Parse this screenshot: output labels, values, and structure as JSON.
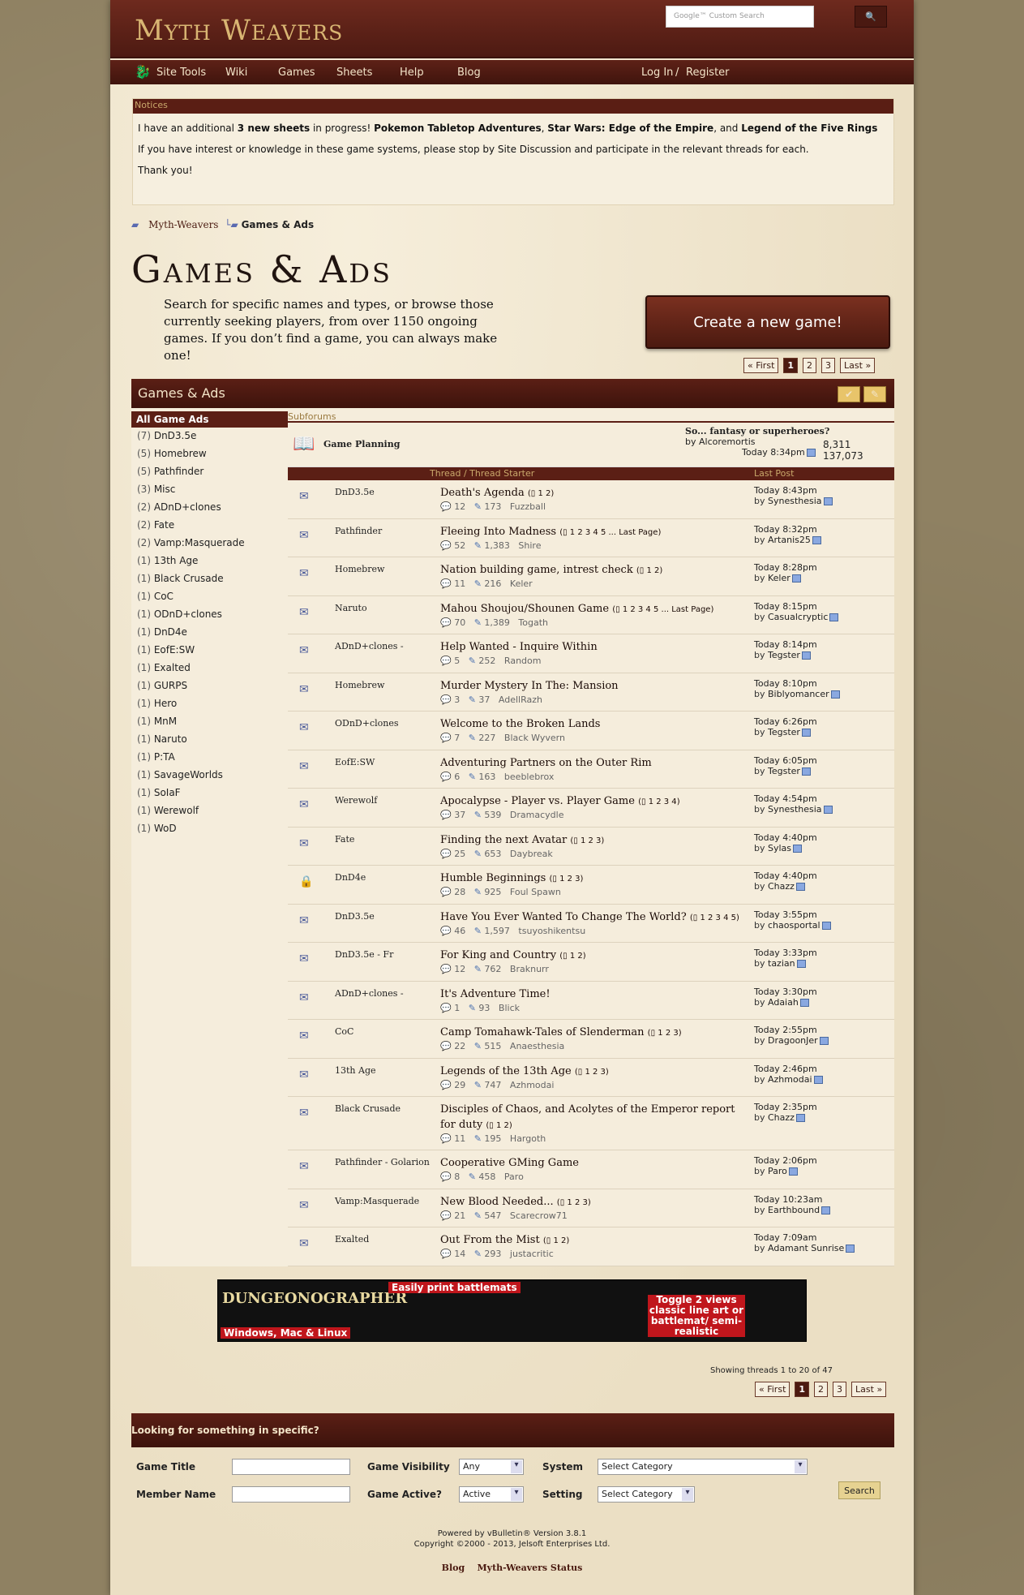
{
  "header": {
    "logo": "Myth Weavers",
    "search_placeholder": "Google™ Custom Search"
  },
  "nav": {
    "items": [
      "Site Tools",
      "Wiki",
      "Games",
      "Sheets",
      "Help",
      "Blog"
    ],
    "login": "Log In",
    "sep": "/",
    "register": "Register"
  },
  "notices": {
    "title": "Notices",
    "line1_a": "I have an additional ",
    "line1_b": "3 new sheets",
    "line1_c": " in progress! ",
    "line1_d": "Pokemon Tabletop Adventures",
    "line1_e": ", ",
    "line1_f": "Star Wars: Edge of the Empire",
    "line1_g": ", and ",
    "line1_h": "Legend of the Five Rings",
    "line2": "If you have interest or knowledge in these game systems, please stop by Site Discussion and participate in the relevant threads for each.",
    "line3": "Thank you!"
  },
  "breadcrumb": {
    "home": "Myth-Weavers",
    "current": "Games & Ads"
  },
  "page": {
    "title": "Games & Ads",
    "intro": "Search for specific names and types, or browse those currently seeking players, from over 1150 ongoing games. If you don’t find a game, you can always make one!",
    "create_button": "Create a new game!"
  },
  "pager": {
    "first": "« First",
    "pages": [
      "1",
      "2",
      "3"
    ],
    "last": "Last »"
  },
  "forum": {
    "header": "Games & Ads",
    "all_games": "All Game Ads",
    "subforums_label": "Subforums",
    "thread_col": "Thread / Thread Starter",
    "lastpost_col": "Last Post"
  },
  "categories": [
    [
      "(7)",
      "DnD3.5e"
    ],
    [
      "(5)",
      "Homebrew"
    ],
    [
      "(5)",
      "Pathfinder"
    ],
    [
      "(3)",
      "Misc"
    ],
    [
      "(2)",
      "ADnD+clones"
    ],
    [
      "(2)",
      "Fate"
    ],
    [
      "(2)",
      "Vamp:Masquerade"
    ],
    [
      "(1)",
      "13th Age"
    ],
    [
      "(1)",
      "Black Crusade"
    ],
    [
      "(1)",
      "CoC"
    ],
    [
      "(1)",
      "ODnD+clones"
    ],
    [
      "(1)",
      "DnD4e"
    ],
    [
      "(1)",
      "EofE:SW"
    ],
    [
      "(1)",
      "Exalted"
    ],
    [
      "(1)",
      "GURPS"
    ],
    [
      "(1)",
      "Hero"
    ],
    [
      "(1)",
      "MnM"
    ],
    [
      "(1)",
      "Naruto"
    ],
    [
      "(1)",
      "P:TA"
    ],
    [
      "(1)",
      "SavageWorlds"
    ],
    [
      "(1)",
      "SoIaF"
    ],
    [
      "(1)",
      "Werewolf"
    ],
    [
      "(1)",
      "WoD"
    ]
  ],
  "subforum": {
    "name": "Game Planning",
    "last_title": "So... fantasy or superheroes?",
    "by": "by",
    "last_user": "Alcoremortis",
    "last_time": "Today 8:34pm",
    "threads": "8,311",
    "posts": "137,073"
  },
  "threads": [
    {
      "forum": "DnD3.5e",
      "title": "Death's Agenda",
      "pages": "1 2",
      "replies": "12",
      "views": "173",
      "starter": "Fuzzball",
      "time": "Today 8:43pm",
      "user": "Synesthesia"
    },
    {
      "forum": "Pathfinder",
      "title": "Fleeing Into Madness",
      "pages": "1 2 3 4 5 ... Last Page",
      "replies": "52",
      "views": "1,383",
      "starter": "Shire",
      "time": "Today 8:32pm",
      "user": "Artanis25"
    },
    {
      "forum": "Homebrew",
      "title": "Nation building game, intrest check",
      "pages": "1 2",
      "replies": "11",
      "views": "216",
      "starter": "Keler",
      "time": "Today 8:28pm",
      "user": "Keler"
    },
    {
      "forum": "Naruto",
      "title": "Mahou Shoujou/Shounen Game",
      "pages": "1 2 3 4 5 ... Last Page",
      "replies": "70",
      "views": "1,389",
      "starter": "Togath",
      "time": "Today 8:15pm",
      "user": "Casualcryptic"
    },
    {
      "forum": "ADnD+clones -",
      "title": "Help Wanted - Inquire Within",
      "pages": "",
      "replies": "5",
      "views": "252",
      "starter": "Random",
      "time": "Today 8:14pm",
      "user": "Tegster"
    },
    {
      "forum": "Homebrew",
      "title": "Murder Mystery In The: Mansion",
      "pages": "",
      "replies": "3",
      "views": "37",
      "starter": "AdellRazh",
      "time": "Today 8:10pm",
      "user": "Biblyomancer"
    },
    {
      "forum": "ODnD+clones",
      "title": "Welcome to the Broken Lands",
      "pages": "",
      "replies": "7",
      "views": "227",
      "starter": "Black Wyvern",
      "time": "Today 6:26pm",
      "user": "Tegster"
    },
    {
      "forum": "EofE:SW",
      "title": "Adventuring Partners on the Outer Rim",
      "pages": "",
      "replies": "6",
      "views": "163",
      "starter": "beeblebrox",
      "time": "Today 6:05pm",
      "user": "Tegster"
    },
    {
      "forum": "Werewolf",
      "title": "Apocalypse - Player vs. Player Game",
      "pages": "1 2 3 4",
      "replies": "37",
      "views": "539",
      "starter": "Dramacydle",
      "time": "Today 4:54pm",
      "user": "Synesthesia"
    },
    {
      "forum": "Fate",
      "title": "Finding the next Avatar",
      "pages": "1 2 3",
      "replies": "25",
      "views": "653",
      "starter": "Daybreak",
      "time": "Today 4:40pm",
      "user": "Sylas"
    },
    {
      "forum": "DnD4e",
      "title": "Humble Beginnings",
      "pages": "1 2 3",
      "replies": "28",
      "views": "925",
      "starter": "Foul Spawn",
      "time": "Today 4:40pm",
      "user": "Chazz",
      "locked": true
    },
    {
      "forum": "DnD3.5e",
      "title": "Have You Ever Wanted To Change The World?",
      "pages": "1 2 3 4 5",
      "replies": "46",
      "views": "1,597",
      "starter": "tsuyoshikentsu",
      "time": "Today 3:55pm",
      "user": "chaosportal"
    },
    {
      "forum": "DnD3.5e - Fr",
      "title": "For King and Country",
      "pages": "1 2",
      "replies": "12",
      "views": "762",
      "starter": "Braknurr",
      "time": "Today 3:33pm",
      "user": "tazian"
    },
    {
      "forum": "ADnD+clones -",
      "title": "It's Adventure Time!",
      "pages": "",
      "replies": "1",
      "views": "93",
      "starter": "Blick",
      "time": "Today 3:30pm",
      "user": "Adaiah"
    },
    {
      "forum": "CoC",
      "title": "Camp Tomahawk-Tales of Slenderman",
      "pages": "1 2 3",
      "replies": "22",
      "views": "515",
      "starter": "Anaesthesia",
      "time": "Today 2:55pm",
      "user": "DragoonJer"
    },
    {
      "forum": "13th Age",
      "title": "Legends of the 13th Age",
      "pages": "1 2 3",
      "replies": "29",
      "views": "747",
      "starter": "Azhmodai",
      "time": "Today 2:46pm",
      "user": "Azhmodai"
    },
    {
      "forum": "Black Crusade",
      "title": "Disciples of Chaos, and Acolytes of the Emperor report for duty",
      "pages": "1 2",
      "replies": "11",
      "views": "195",
      "starter": "Hargoth",
      "time": "Today 2:35pm",
      "user": "Chazz",
      "tall": true
    },
    {
      "forum": "Pathfinder - Golarion",
      "title": "Cooperative GMing Game",
      "pages": "",
      "replies": "8",
      "views": "458",
      "starter": "Paro",
      "time": "Today 2:06pm",
      "user": "Paro"
    },
    {
      "forum": "Vamp:Masquerade",
      "title": "New Blood Needed...",
      "pages": "1 2 3",
      "replies": "21",
      "views": "547",
      "starter": "Scarecrow71",
      "time": "Today 10:23am",
      "user": "Earthbound"
    },
    {
      "forum": "Exalted",
      "title": "Out From the Mist",
      "pages": "1 2",
      "replies": "14",
      "views": "293",
      "starter": "justacritic",
      "time": "Today 7:09am",
      "user": "Adamant Sunrise"
    }
  ],
  "ad": {
    "brand": "DUNGEONOGRAPHER",
    "tag1": "Easily print battlemats",
    "tag2": "Windows, Mac & Linux",
    "tag3": "Toggle 2 views classic line art or battlemat/ semi-realistic"
  },
  "showing": "Showing threads 1 to 20 of 47",
  "search": {
    "header": "Looking for something in specific?",
    "game_title": "Game Title",
    "member_name": "Member Name",
    "visibility": "Game Visibility",
    "visibility_val": "Any",
    "active": "Game Active?",
    "active_val": "Active",
    "system": "System",
    "system_val": "Select Category",
    "setting": "Setting",
    "setting_val": "Select Category",
    "button": "Search"
  },
  "footer": {
    "line1": "Powered by vBulletin® Version 3.8.1",
    "line2": "Copyright ©2000 - 2013, Jelsoft Enterprises Ltd.",
    "link1": "Blog",
    "link2": "Myth-Weavers Status"
  }
}
